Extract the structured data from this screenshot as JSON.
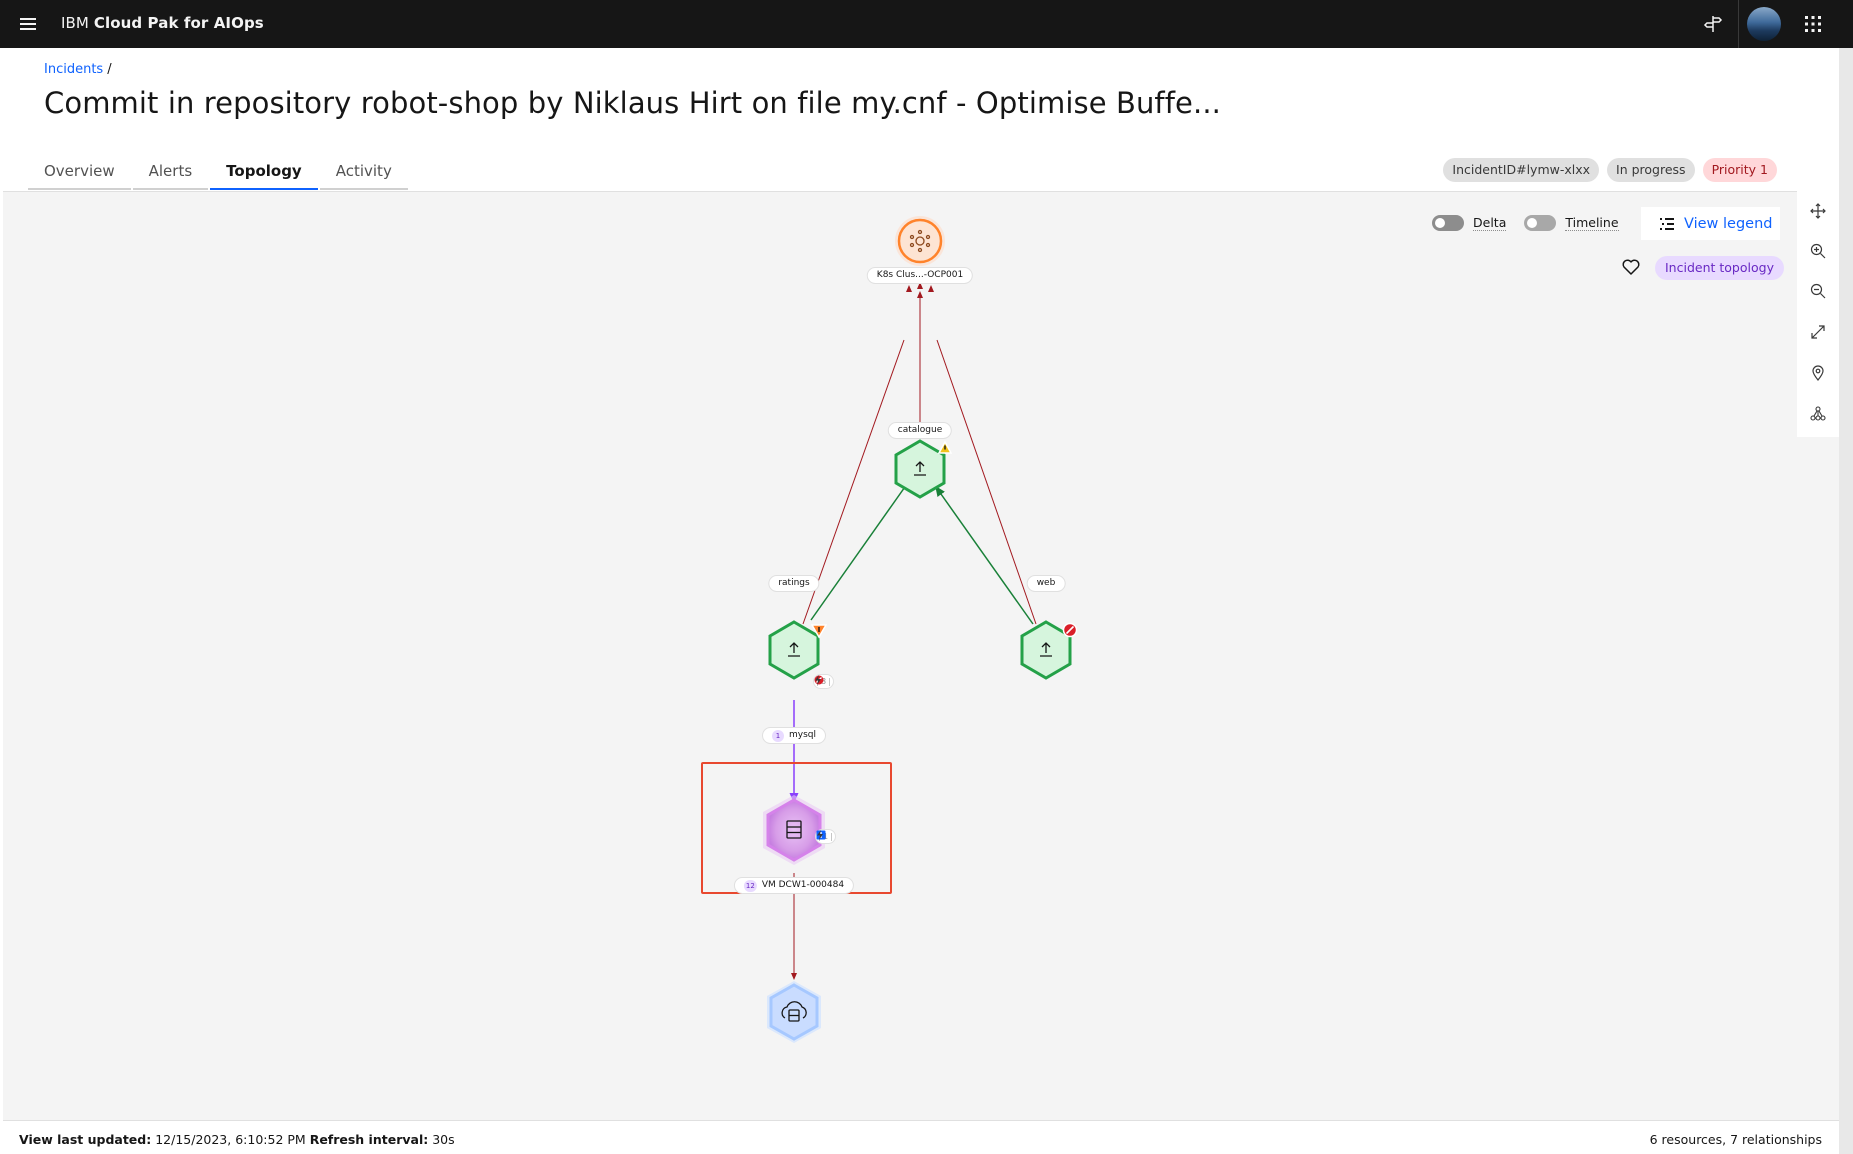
{
  "header": {
    "brand_prefix": "IBM",
    "brand_product": "Cloud Pak for AIOps",
    "icons": [
      "menu-icon",
      "signpost-icon",
      "user-avatar",
      "app-switcher-icon"
    ]
  },
  "breadcrumb": {
    "parent": "Incidents",
    "separator": "/"
  },
  "page": {
    "title": "Commit in repository robot-shop by Niklaus Hirt on file my.cnf - Optimise Buffe..."
  },
  "tabs": [
    {
      "label": "Overview",
      "active": false
    },
    {
      "label": "Alerts",
      "active": false
    },
    {
      "label": "Topology",
      "active": true
    },
    {
      "label": "Activity",
      "active": false
    }
  ],
  "tags": {
    "incident_id": "IncidentID#lymw-xlxx",
    "status": "In progress",
    "priority": "Priority 1"
  },
  "toolbar": {
    "delta_label": "Delta",
    "delta_on": false,
    "timeline_label": "Timeline",
    "timeline_on": false,
    "legend_label": "View legend",
    "topology_tag": "Incident topology"
  },
  "side_tools": [
    "move-icon",
    "zoom-in-icon",
    "zoom-out-icon",
    "fit-to-screen-icon",
    "location-icon",
    "topology-layout-icon"
  ],
  "topology": {
    "nodes": [
      {
        "id": "k8s",
        "label": "K8s Clus...-OCP001",
        "kind": "cluster",
        "color": "#ff832b"
      },
      {
        "id": "catalogue",
        "label": "catalogue",
        "kind": "service",
        "status": "warning",
        "color": "#24a148"
      },
      {
        "id": "ratings",
        "label": "ratings",
        "kind": "service",
        "status": "minor",
        "color": "#24a148"
      },
      {
        "id": "web",
        "label": "web",
        "kind": "service",
        "status": "critical",
        "color": "#24a148"
      },
      {
        "id": "mysql",
        "label": "mysql",
        "kind": "database",
        "status": "critical",
        "count": "1",
        "alert_count": "8",
        "color": "#d02670",
        "selected": true
      },
      {
        "id": "vm",
        "label": "VM DCW1-000484",
        "kind": "vm",
        "status": "info",
        "count": "12",
        "alert_count": "1",
        "color": "#4589ff"
      }
    ],
    "edges": [
      {
        "from": "catalogue",
        "to": "k8s",
        "color": "#a2191f"
      },
      {
        "from": "ratings",
        "to": "k8s",
        "color": "#a2191f"
      },
      {
        "from": "web",
        "to": "k8s",
        "color": "#a2191f"
      },
      {
        "from": "catalogue",
        "to": "ratings",
        "color": "#198038"
      },
      {
        "from": "web",
        "to": "catalogue",
        "color": "#198038"
      },
      {
        "from": "ratings",
        "to": "mysql",
        "color": "#8a3ffc"
      },
      {
        "from": "mysql",
        "to": "vm",
        "color": "#a2191f"
      }
    ]
  },
  "footer": {
    "updated_label": "View last updated:",
    "updated_value": "12/15/2023, 6:10:52 PM",
    "refresh_label": "Refresh interval:",
    "refresh_value": "30s",
    "summary": "6 resources, 7 relationships"
  }
}
